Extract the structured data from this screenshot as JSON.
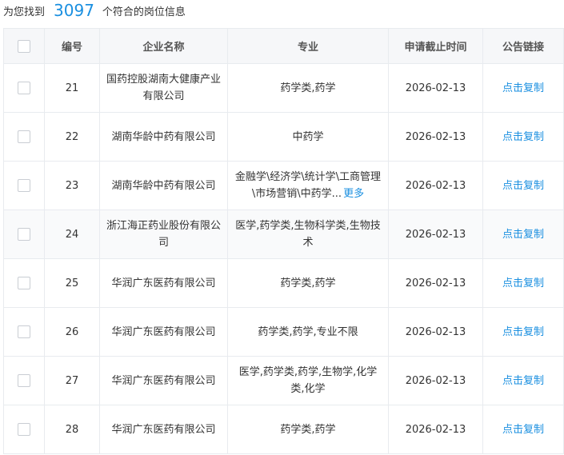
{
  "summary": {
    "prefix": "为您找到",
    "count": "3097",
    "suffix": "个符合的岗位信息"
  },
  "table": {
    "headers": {
      "number": "编号",
      "company": "企业名称",
      "major": "专业",
      "deadline": "申请截止时间",
      "link": "公告链接"
    },
    "rows": [
      {
        "number": "21",
        "company": "国药控股湖南大健康产业有限公司",
        "major": "药学类,药学",
        "more": "",
        "deadline": "2026-02-13",
        "link": "点击复制"
      },
      {
        "number": "22",
        "company": "湖南华龄中药有限公司",
        "major": "中药学",
        "more": "",
        "deadline": "2026-02-13",
        "link": "点击复制"
      },
      {
        "number": "23",
        "company": "湖南华龄中药有限公司",
        "major": "金融学\\经济学\\统计学\\工商管理\\市场营销\\中药学...",
        "more": "更多",
        "deadline": "2026-02-13",
        "link": "点击复制"
      },
      {
        "number": "24",
        "company": "浙江海正药业股份有限公司",
        "major": "医学,药学类,生物科学类,生物技术",
        "more": "",
        "deadline": "2026-02-13",
        "link": "点击复制"
      },
      {
        "number": "25",
        "company": "华润广东医药有限公司",
        "major": "药学类,药学",
        "more": "",
        "deadline": "2026-02-13",
        "link": "点击复制"
      },
      {
        "number": "26",
        "company": "华润广东医药有限公司",
        "major": "药学类,药学,专业不限",
        "more": "",
        "deadline": "2026-02-13",
        "link": "点击复制"
      },
      {
        "number": "27",
        "company": "华润广东医药有限公司",
        "major": "医学,药学类,药学,生物学,化学类,化学",
        "more": "",
        "deadline": "2026-02-13",
        "link": "点击复制"
      },
      {
        "number": "28",
        "company": "华润广东医药有限公司",
        "major": "药学类,药学",
        "more": "",
        "deadline": "2026-02-13",
        "link": "点击复制"
      }
    ]
  },
  "colors": {
    "accent": "#1a8fe0",
    "header_bg": "#f6f7f9",
    "border": "#e8ebef"
  }
}
